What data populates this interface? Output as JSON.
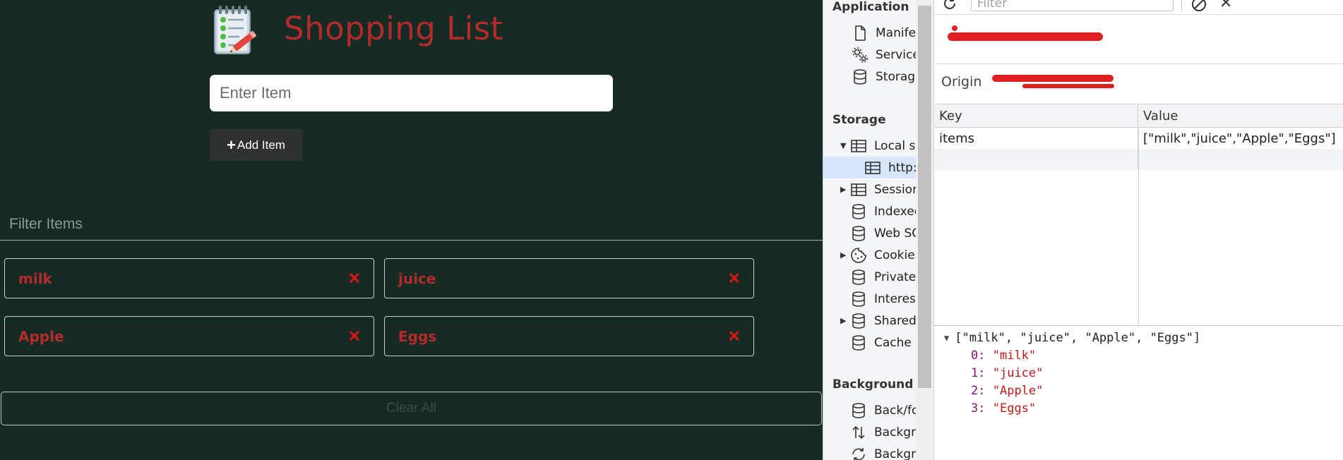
{
  "app": {
    "title": "Shopping List",
    "item_input_placeholder": "Enter Item",
    "add_button_label": "Add Item",
    "filter_placeholder": "Filter Items",
    "items": [
      "milk",
      "juice",
      "Apple",
      "Eggs"
    ],
    "remove_glyph": "✕",
    "clear_button_label": "Clear All",
    "colors": {
      "background": "#172b25",
      "accent": "#b52a2a",
      "remove": "#e01414"
    }
  },
  "devtools": {
    "sections": {
      "application": "Application",
      "storage": "Storage",
      "background": "Background services"
    },
    "application_items": [
      {
        "label": "Manifest",
        "icon": "file-icon"
      },
      {
        "label": "Service workers",
        "icon": "gears-icon"
      },
      {
        "label": "Storage",
        "icon": "database-icon"
      }
    ],
    "storage_items": [
      {
        "label": "Local storage",
        "icon": "table-icon",
        "arrow": "▼"
      },
      {
        "label": "http://",
        "icon": "table-icon",
        "arrow": ""
      },
      {
        "label": "Session storage",
        "icon": "table-icon",
        "arrow": "▶"
      },
      {
        "label": "IndexedDB",
        "icon": "database-icon",
        "arrow": ""
      },
      {
        "label": "Web SQL",
        "icon": "database-icon",
        "arrow": ""
      },
      {
        "label": "Cookies",
        "icon": "cookie-icon",
        "arrow": "▶"
      },
      {
        "label": "Private state tokens",
        "icon": "database-icon",
        "arrow": ""
      },
      {
        "label": "Interest groups",
        "icon": "database-icon",
        "arrow": ""
      },
      {
        "label": "Shared storage",
        "icon": "database-icon",
        "arrow": "▶"
      },
      {
        "label": "Cache storage",
        "icon": "database-icon",
        "arrow": ""
      }
    ],
    "background_items": [
      {
        "label": "Back/forward cache",
        "icon": "database-icon"
      },
      {
        "label": "Background fetch",
        "icon": "updown-icon"
      },
      {
        "label": "Background sync",
        "icon": "sync-icon"
      }
    ],
    "toolbar": {
      "filter_placeholder": "Filter"
    },
    "origin_label": "Origin",
    "table": {
      "key_header": "Key",
      "value_header": "Value",
      "rows": [
        {
          "key": "items",
          "value": "[\"milk\",\"juice\",\"Apple\",\"Eggs\"]"
        }
      ]
    },
    "preview": {
      "summary": "[\"milk\", \"juice\", \"Apple\", \"Eggs\"]",
      "entries": [
        {
          "index": "0",
          "value": "\"milk\""
        },
        {
          "index": "1",
          "value": "\"juice\""
        },
        {
          "index": "2",
          "value": "\"Apple\""
        },
        {
          "index": "3",
          "value": "\"Eggs\""
        }
      ]
    }
  }
}
